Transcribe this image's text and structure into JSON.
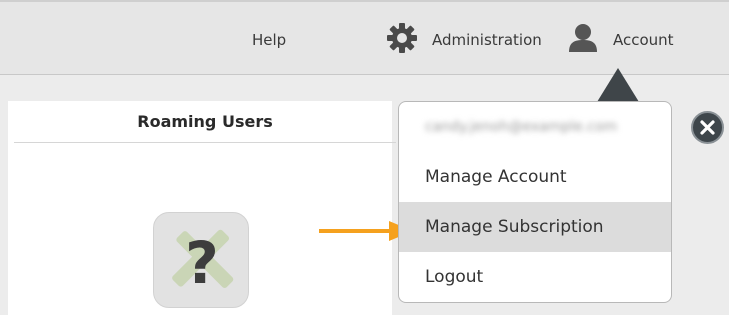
{
  "topnav": {
    "help_label": "Help",
    "admin_label": "Administration",
    "account_label": "Account",
    "admin_icon": "gear-icon",
    "account_icon": "user-icon"
  },
  "panel": {
    "title": "Roaming Users",
    "app_icon": "help-question-icon"
  },
  "dropdown": {
    "email_label": "candy.jenoh@example.com",
    "items": [
      "Manage Account",
      "Manage Subscription",
      "Logout"
    ]
  },
  "colors": {
    "arrow": "#f5a11e",
    "caret": "#3f4549",
    "highlight": "#dcdcdc"
  }
}
